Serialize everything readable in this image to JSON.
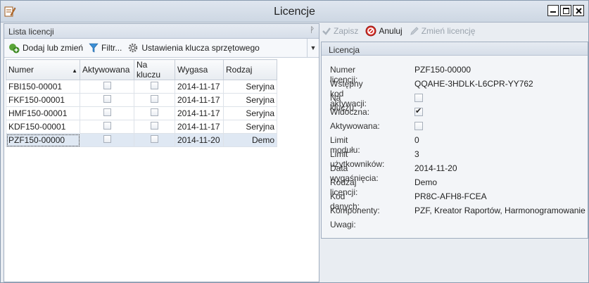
{
  "window": {
    "title": "Licencje"
  },
  "left": {
    "panel_title": "Lista licencji",
    "toolbar": {
      "add_label": "Dodaj lub zmień",
      "filter_label": "Filtr...",
      "hw_key_label": "Ustawienia klucza sprzętowego"
    },
    "columns": [
      "Numer",
      "Aktywowana",
      "Na kluczu",
      "Wygasa",
      "Rodzaj"
    ],
    "rows": [
      {
        "numer": "FBI150-00001",
        "aktywowana": false,
        "na_kluczu": false,
        "wygasa": "2014-11-17",
        "rodzaj": "Seryjna"
      },
      {
        "numer": "FKF150-00001",
        "aktywowana": false,
        "na_kluczu": false,
        "wygasa": "2014-11-17",
        "rodzaj": "Seryjna"
      },
      {
        "numer": "HMF150-00001",
        "aktywowana": false,
        "na_kluczu": false,
        "wygasa": "2014-11-17",
        "rodzaj": "Seryjna"
      },
      {
        "numer": "KDF150-00001",
        "aktywowana": false,
        "na_kluczu": false,
        "wygasa": "2014-11-17",
        "rodzaj": "Seryjna"
      },
      {
        "numer": "PZF150-00000",
        "aktywowana": false,
        "na_kluczu": false,
        "wygasa": "2014-11-20",
        "rodzaj": "Demo",
        "selected": true
      }
    ]
  },
  "right": {
    "toolbar": {
      "save_label": "Zapisz",
      "cancel_label": "Anuluj",
      "change_label": "Zmień licencję"
    },
    "panel_title": "Licencja",
    "fields": {
      "numer_label": "Numer licencji:",
      "numer": "PZF150-00000",
      "kod_label": "Wstępny kod aktywacji:",
      "kod": "QQAHE-3HDLK-L6CPR-YY762",
      "naklucz_label": "Na kluczu:",
      "naklucz": false,
      "widoczna_label": "Widoczna:",
      "widoczna": true,
      "aktyw_label": "Aktywowana:",
      "aktyw": false,
      "limit_mod_label": "Limit modułu:",
      "limit_mod": "0",
      "limit_uz_label": "Limit użytkowników:",
      "limit_uz": "3",
      "data_label": "Data wygaśnięcia:",
      "data": "2014-11-20",
      "rodzaj_label": "Rodzaj licencji:",
      "rodzaj": "Demo",
      "kod_danych_label": "Kod danych:",
      "kod_danych": "PR8C-AFH8-FCEA",
      "komponenty_label": "Komponenty:",
      "komponenty": "PZF, Kreator Raportów, Harmonogramowanie",
      "uwagi_label": "Uwagi:"
    }
  }
}
